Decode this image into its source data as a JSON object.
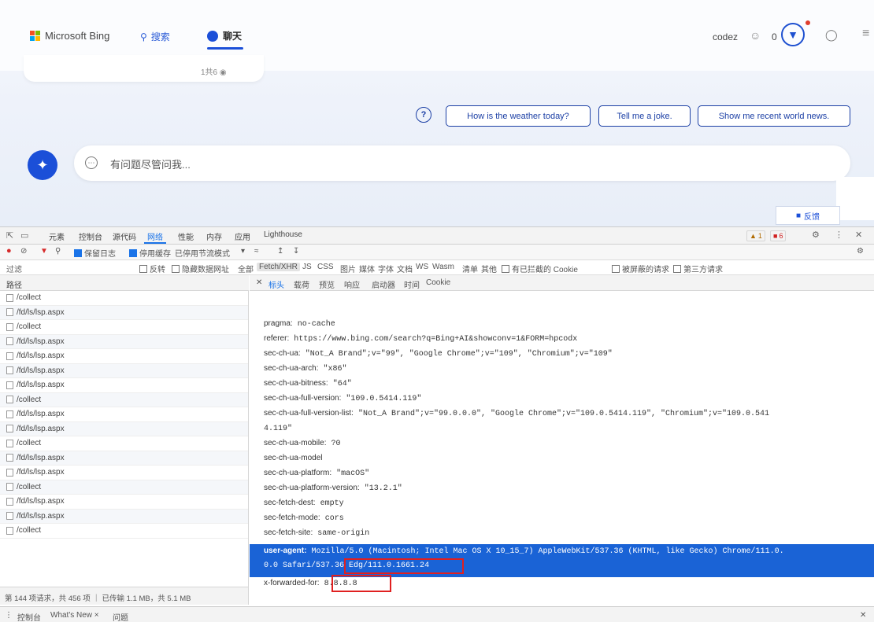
{
  "bing": {
    "logo_text": "Microsoft Bing",
    "nav_search": "搜索",
    "nav_chat": "聊天",
    "user_name": "codez",
    "points": "0",
    "card_text": "1共6 ◉",
    "suggestions": [
      "How is the weather today?",
      "Tell me a joke.",
      "Show me recent world news."
    ],
    "ask_placeholder": "有问题尽管问我...",
    "feedback_label": "反馈",
    "colors": {
      "brand": "#1b4fd8",
      "pill_border": "#1b3fa5"
    }
  },
  "devtools": {
    "tabs": [
      "元素",
      "控制台",
      "源代码",
      "网络",
      "性能",
      "内存",
      "应用",
      "Lighthouse"
    ],
    "active_tab": "网络",
    "warn_count": "1",
    "error_count": "6",
    "toolbar": {
      "preserve_log": "保留日志",
      "disable_cache": "停用缓存",
      "throttle": "已停用节流模式"
    },
    "filter": {
      "placeholder": "过滤",
      "invert": "反转",
      "hide_data_urls": "隐藏数据网址",
      "types": [
        "全部",
        "Fetch/XHR",
        "JS",
        "CSS",
        "图片",
        "媒体",
        "字体",
        "文档",
        "WS",
        "Wasm",
        "清单",
        "其他"
      ],
      "blocked_cookies": "有已拦截的 Cookie",
      "blocked_requests": "被屏蔽的请求",
      "third_party": "第三方请求"
    },
    "list_header": "路径",
    "requests": [
      "/collect",
      "/fd/ls/lsp.aspx",
      "/collect",
      "/fd/ls/lsp.aspx",
      "/fd/ls/lsp.aspx",
      "/fd/ls/lsp.aspx",
      "/fd/ls/lsp.aspx",
      "/collect",
      "/fd/ls/lsp.aspx",
      "/fd/ls/lsp.aspx",
      "/collect",
      "/fd/ls/lsp.aspx",
      "/fd/ls/lsp.aspx",
      "/collect",
      "/fd/ls/lsp.aspx",
      "/fd/ls/lsp.aspx",
      "/collect"
    ],
    "status": "第 144 项请求，共 456 项 ｜ 已传输 1.1 MB，共 5.1 MB",
    "detail_tabs": [
      "标头",
      "载荷",
      "预览",
      "响应",
      "启动器",
      "时间",
      "Cookie"
    ],
    "headers": [
      {
        "k": "pragma:",
        "v": "no-cache"
      },
      {
        "k": "referer:",
        "v": "https://www.bing.com/search?q=Bing+AI&showconv=1&FORM=hpcodx"
      },
      {
        "k": "sec-ch-ua:",
        "v": "\"Not_A Brand\";v=\"99\", \"Google Chrome\";v=\"109\", \"Chromium\";v=\"109\""
      },
      {
        "k": "sec-ch-ua-arch:",
        "v": "\"x86\""
      },
      {
        "k": "sec-ch-ua-bitness:",
        "v": "\"64\""
      },
      {
        "k": "sec-ch-ua-full-version:",
        "v": "\"109.0.5414.119\""
      },
      {
        "k": "sec-ch-ua-full-version-list:",
        "v": "\"Not_A Brand\";v=\"99.0.0.0\", \"Google Chrome\";v=\"109.0.5414.119\", \"Chromium\";v=\"109.0.541"
      },
      {
        "k": "",
        "v": "4.119\""
      },
      {
        "k": "sec-ch-ua-mobile:",
        "v": "?0"
      },
      {
        "k": "sec-ch-ua-model",
        "v": ""
      },
      {
        "k": "sec-ch-ua-platform:",
        "v": "\"macOS\""
      },
      {
        "k": "sec-ch-ua-platform-version:",
        "v": "\"13.2.1\""
      },
      {
        "k": "sec-fetch-dest:",
        "v": "empty"
      },
      {
        "k": "sec-fetch-mode:",
        "v": "cors"
      },
      {
        "k": "sec-fetch-site:",
        "v": "same-origin"
      }
    ],
    "user_agent": {
      "k": "user-agent:",
      "line1": "Mozilla/5.0 (Macintosh; Intel Mac OS X 10_15_7) AppleWebKit/537.36 (KHTML, like Gecko) Chrome/111.0.",
      "line2a": "0.0 Safari/537.36",
      "line2b": "Edg/111.0.1661.24"
    },
    "xff": {
      "k": "x-forwarded-for:",
      "v": "8.8.8.8"
    },
    "drawer": [
      "控制台",
      "What's New ×",
      "问题"
    ]
  }
}
